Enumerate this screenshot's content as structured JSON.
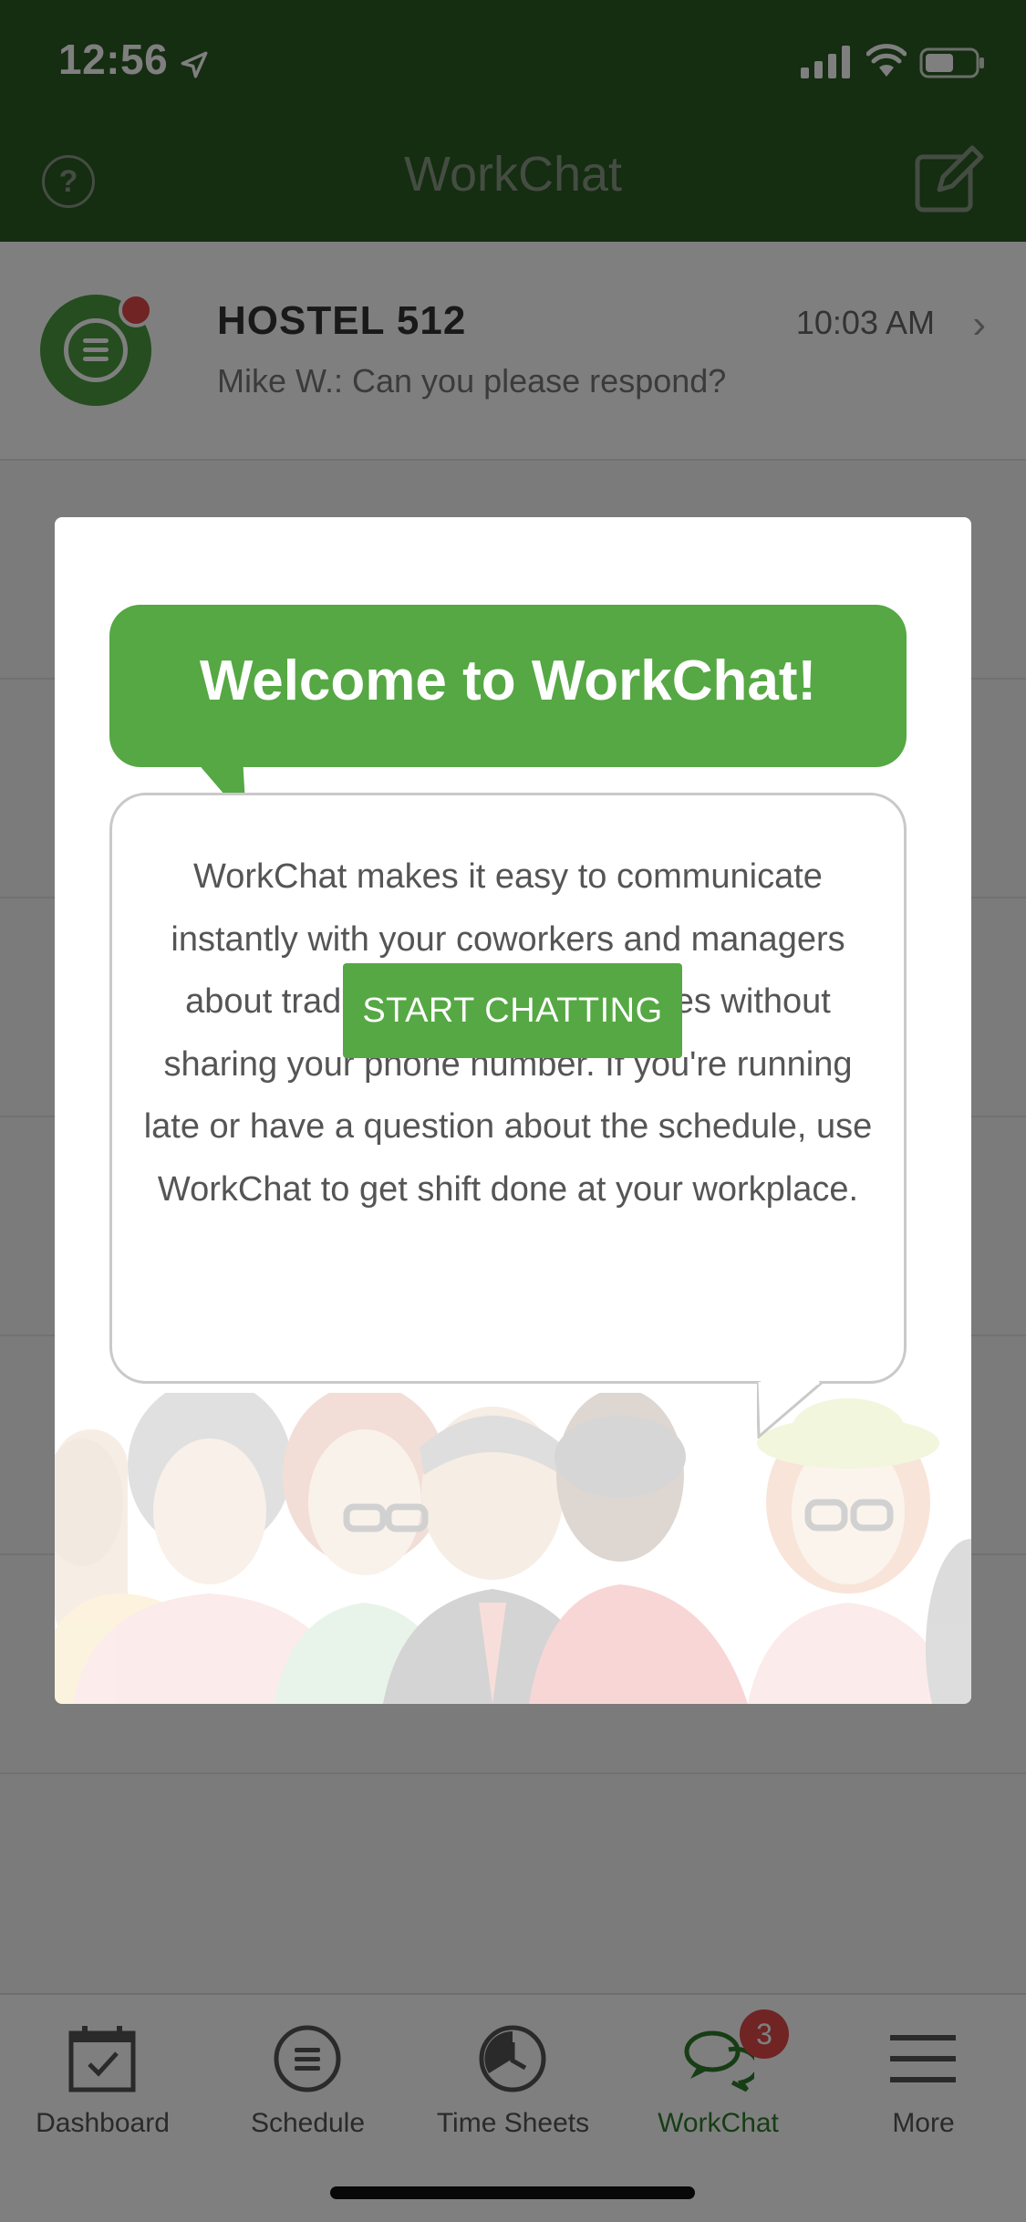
{
  "status_bar": {
    "time": "12:56"
  },
  "header": {
    "title": "WorkChat",
    "help_label": "?"
  },
  "chats": [
    {
      "name": "HOSTEL 512",
      "preview": "Mike W.: Can you please respond?",
      "time": "10:03 AM"
    }
  ],
  "modal": {
    "title": "Welcome to WorkChat!",
    "body": "WorkChat makes it easy to communicate instantly with your coworkers and managers about trading shifts and schedules without sharing your phone number. If you're running late or have a question about the schedule, use WorkChat to get shift done at your workplace.",
    "button": "START CHATTING"
  },
  "tabs": [
    {
      "label": "Dashboard",
      "icon": "calendar-check-icon"
    },
    {
      "label": "Schedule",
      "icon": "schedule-icon"
    },
    {
      "label": "Time Sheets",
      "icon": "clock-icon"
    },
    {
      "label": "WorkChat",
      "icon": "chat-bubbles-icon",
      "badge": "3",
      "active": true
    },
    {
      "label": "More",
      "icon": "hamburger-icon"
    }
  ],
  "colors": {
    "brand_dark": "#2b5a22",
    "brand_green": "#55a843",
    "badge_red": "#e04848"
  }
}
